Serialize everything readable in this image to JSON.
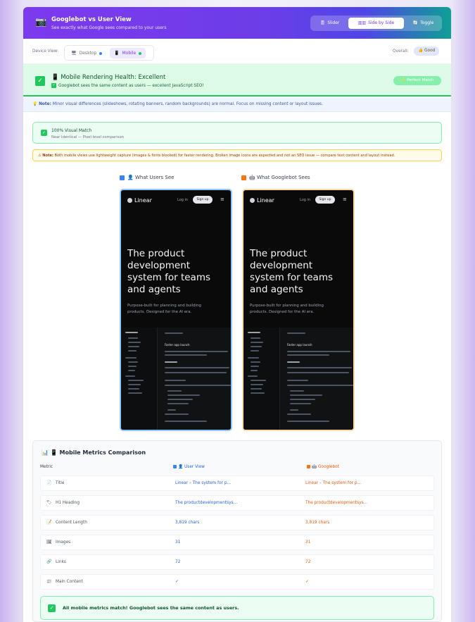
{
  "header": {
    "icon": "📷",
    "title": "Googlebot vs User View",
    "subtitle": "See exactly what Google sees compared to your users",
    "modes": [
      {
        "label": "Slider",
        "icon": "🎚",
        "active": false
      },
      {
        "label": "Side by Side",
        "icon": "▥▥",
        "active": true
      },
      {
        "label": "Toggle",
        "icon": "🔄",
        "active": false
      }
    ]
  },
  "device": {
    "label": "Device View:",
    "options": [
      {
        "label": "Desktop",
        "icon": "🖥",
        "dot_color": "#3b82f6"
      },
      {
        "label": "Mobile",
        "icon": "📱",
        "dot_color": "#22c55e"
      }
    ],
    "overall_label": "Overall:",
    "overall_value": "👍 Good"
  },
  "health": {
    "icon": "📱",
    "title": "Mobile Rendering Health: Excellent",
    "subtitle": "Googlebot sees the same content as users — excellent JavaScript SEO!",
    "badge": "✨ Perfect Match"
  },
  "note": {
    "icon": "💡",
    "bold": "Note:",
    "text": " Minor visual differences (slideshows, rotating banners, random backgrounds) are normal. Focus on missing content or layout issues."
  },
  "visual_match": {
    "title": "100% Visual Match",
    "subtitle": "Near Identical — Pixel-level comparison"
  },
  "warning": {
    "icon": "⚠",
    "bold": "Note:",
    "text": " Both mobile views use lightweight capture (images & fonts blocked) for faster rendering. Broken image icons are expected and not an SEO issue — compare text content and layout instead."
  },
  "phones": {
    "user_label": "👤 What Users See",
    "googlebot_label": "🤖 What Googlebot Sees",
    "user_color": "#3b82f6",
    "googlebot_color": "#f97316",
    "site": {
      "logo": "Linear",
      "login": "Log in",
      "signup": "Sign up",
      "hero": "The product development system for teams and agents",
      "description": "Purpose-built for planning and building products. Designed for the AI era.",
      "app_title": "Faster app launch"
    }
  },
  "metrics": {
    "title": "Mobile Metrics Comparison",
    "title_icons": "📊 📱",
    "col_metric": "Metric",
    "col_user": "👤 User View",
    "col_googlebot": "🤖 Googlebot",
    "rows": [
      {
        "icon": "📄",
        "metric": "Title",
        "user": "Linear – The system for p...",
        "googlebot": "Linear – The system for p..."
      },
      {
        "icon": "🏷",
        "metric": "H1 Heading",
        "user": "The productdevelopmentsys...",
        "googlebot": "The productdevelopmentsys..."
      },
      {
        "icon": "📝",
        "metric": "Content Length",
        "user": "3,819 chars",
        "googlebot": "3,819 chars"
      },
      {
        "icon": "🖼",
        "metric": "Images",
        "user": "31",
        "googlebot": "31"
      },
      {
        "icon": "🔗",
        "metric": "Links",
        "user": "72",
        "googlebot": "72"
      },
      {
        "icon": "📰",
        "metric": "Main Content",
        "user": "✓",
        "googlebot": "✓"
      }
    ],
    "footer": "All mobile metrics match! Googlebot sees the same content as users."
  }
}
